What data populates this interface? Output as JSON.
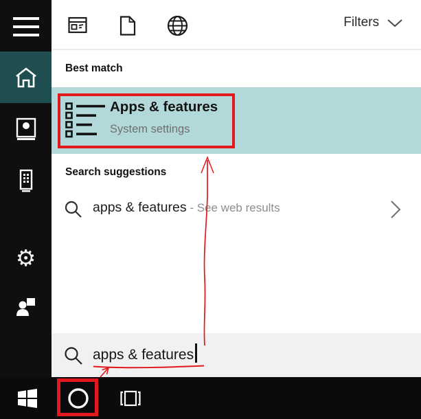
{
  "topbar": {
    "filters_label": "Filters"
  },
  "content": {
    "best_match_header": "Best match",
    "result": {
      "title": "Apps & features",
      "subtitle": "System settings"
    },
    "suggestions_header": "Search suggestions",
    "suggestion": {
      "query": "apps & features",
      "hint": " - See web results"
    }
  },
  "search_box": {
    "value": "apps & features"
  },
  "icons": {
    "hamburger": "menu",
    "home": "house",
    "account": "portrait-frame",
    "device": "device",
    "settings": "⚙",
    "feedback": "person-with-box",
    "apps_filter": "window",
    "documents_filter": "page",
    "web_filter": "globe",
    "filters_chevron": "chevron-down",
    "search": "magnifier",
    "suggestion_chevron": "chevron-right",
    "windows_logo": "windows",
    "cortana": "circle",
    "task_view": "bracketed-square"
  },
  "colors": {
    "highlight": "#b3d8d9",
    "sidebar_selected": "#1f4e50",
    "annotation_red": "#e1191c",
    "taskbar": "#0b0b0e"
  }
}
